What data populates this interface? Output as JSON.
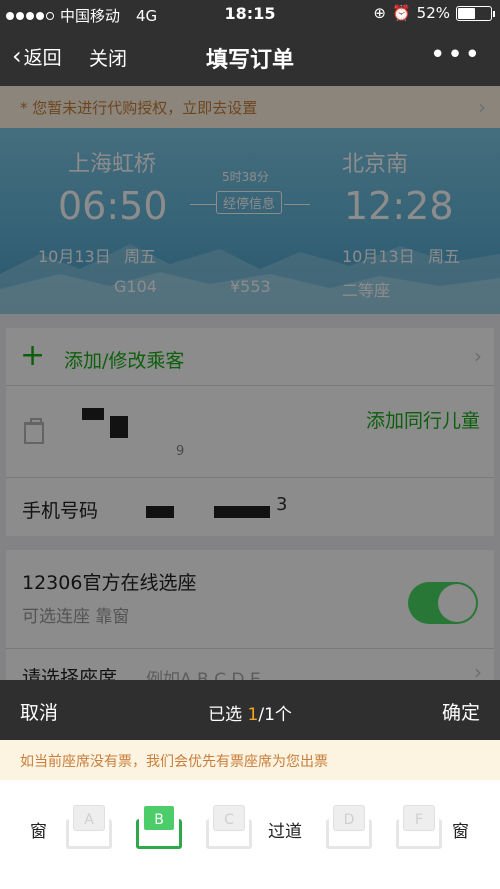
{
  "status_bar": {
    "carrier": "中国移动",
    "network": "4G",
    "time": "18:15",
    "battery": "52%",
    "battery_level": 0.52
  },
  "nav": {
    "back_label": "返回",
    "close_label": "关闭",
    "title": "填写订单",
    "more_label": "•••"
  },
  "notice_banner": "* 您暂未进行代购授权，立即去设置",
  "train": {
    "from_station": "上海虹桥",
    "to_station": "北京南",
    "depart_time": "06:50",
    "arrive_time": "12:28",
    "duration": "5时38分",
    "stop_info": "经停信息",
    "depart_date": "10月13日",
    "depart_weekday": "周五",
    "arrive_date": "10月13日",
    "arrive_weekday": "周五",
    "train_no": "G104",
    "price": "¥553",
    "seat_class": "二等座"
  },
  "passenger_section": {
    "add_label": "添加/修改乘客",
    "add_child_label": "添加同行儿童",
    "name_tail": "9",
    "phone_label": "手机号码",
    "phone_tail": "3"
  },
  "seat_online": {
    "title": "12306官方在线选座",
    "subtitle": "可选连座 靠窗",
    "choose_label": "请选择座席",
    "example": "例如A  B  C  D  E",
    "enabled": true
  },
  "sheet": {
    "cancel_label": "取消",
    "selected_prefix": "已选 ",
    "selected_count": "1",
    "selected_suffix": "/1个",
    "confirm_label": "确定",
    "notice": "如当前座席没有票，我们会优先有票座席为您出票",
    "window_left": "窗",
    "window_right": "窗",
    "aisle": "过道",
    "seats": [
      {
        "letter": "A",
        "selected": false
      },
      {
        "letter": "B",
        "selected": true
      },
      {
        "letter": "C",
        "selected": false
      },
      {
        "letter": "D",
        "selected": false
      },
      {
        "letter": "F",
        "selected": false
      }
    ]
  },
  "colors": {
    "accent_green": "#1aad19",
    "highlight_orange": "#f5a623",
    "dark_bar": "#2f2f2f"
  }
}
